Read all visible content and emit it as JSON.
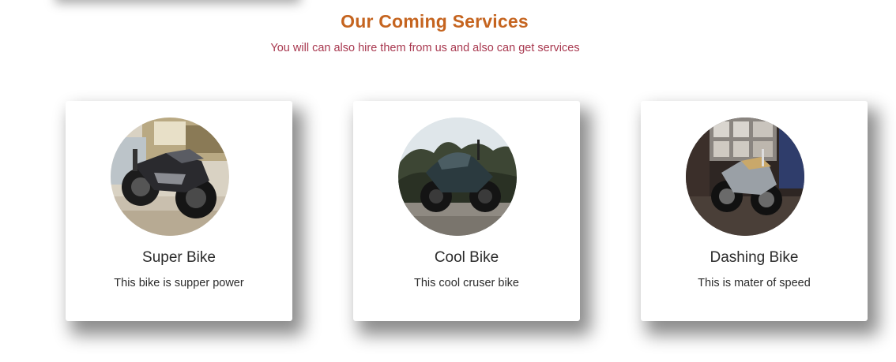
{
  "section": {
    "title": "Our Coming Services",
    "subtitle": "You will can also hire them from us and also can get services"
  },
  "cards": [
    {
      "title": "Super Bike",
      "description": "This bike is supper power",
      "image_icon": "motorcycle-photo"
    },
    {
      "title": "Cool Bike",
      "description": "This cool cruser bike",
      "image_icon": "motorcycle-photo"
    },
    {
      "title": "Dashing Bike",
      "description": "This is mater of speed",
      "image_icon": "motorcycle-photo"
    }
  ],
  "colors": {
    "title": "#c5641f",
    "subtitle": "#a8384f",
    "card_text": "#2b2b2b",
    "background": "#ffffff"
  }
}
